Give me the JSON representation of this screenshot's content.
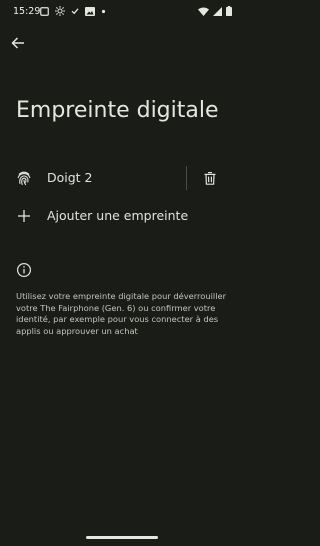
{
  "status_bar": {
    "time": "15:29",
    "left_icons": [
      "screenshot-icon",
      "brightness-icon",
      "check-icon",
      "image-icon",
      "dot-icon"
    ],
    "right_icons": [
      "wifi-icon",
      "cell-signal-icon",
      "battery-icon"
    ]
  },
  "header": {
    "back_icon": "arrow-left-icon",
    "title": "Empreinte digitale"
  },
  "fingerprints": [
    {
      "label": "Doigt 2",
      "icon": "fingerprint-icon",
      "action_icon": "trash-icon"
    }
  ],
  "add_fingerprint": {
    "label": "Ajouter une empreinte",
    "icon": "plus-icon"
  },
  "info": {
    "icon": "info-icon",
    "text": "Utilisez votre empreinte digitale pour déverrouiller votre The Fairphone (Gen. 6) ou confirmer votre identité, par exemple pour vous connecter à des applis ou approuver un achat"
  },
  "colors": {
    "background": "#1a1c18",
    "text_primary": "#e3e3dc",
    "text_secondary": "#c4c6bd"
  }
}
